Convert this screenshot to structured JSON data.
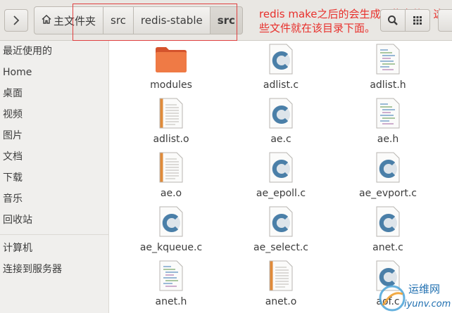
{
  "header": {
    "breadcrumbs": [
      {
        "label": "主文件夹",
        "icon": "home-icon"
      },
      {
        "label": "src"
      },
      {
        "label": "redis-stable"
      },
      {
        "label": "src",
        "active": true
      }
    ],
    "annotation": "redis  make之后的会生成一些文件，这些文件就在该目录下面。",
    "annotation_color": "#e8302c"
  },
  "sidebar": {
    "items": [
      {
        "label": "最近使用的"
      },
      {
        "label": "Home"
      },
      {
        "label": "桌面"
      },
      {
        "label": "视频"
      },
      {
        "label": "图片"
      },
      {
        "label": "文档"
      },
      {
        "label": "下载"
      },
      {
        "label": "音乐"
      },
      {
        "label": "回收站"
      },
      {
        "label": "计算机"
      },
      {
        "label": "连接到服务器"
      }
    ]
  },
  "files": [
    {
      "name": "modules",
      "kind": "folder"
    },
    {
      "name": "adlist.c",
      "kind": "c-source"
    },
    {
      "name": "adlist.h",
      "kind": "header"
    },
    {
      "name": "adlist.o",
      "kind": "object"
    },
    {
      "name": "ae.c",
      "kind": "c-source"
    },
    {
      "name": "ae.h",
      "kind": "header"
    },
    {
      "name": "ae.o",
      "kind": "object"
    },
    {
      "name": "ae_epoll.c",
      "kind": "c-source"
    },
    {
      "name": "ae_evport.c",
      "kind": "c-source"
    },
    {
      "name": "ae_kqueue.c",
      "kind": "c-source"
    },
    {
      "name": "ae_select.c",
      "kind": "c-source"
    },
    {
      "name": "anet.c",
      "kind": "c-source"
    },
    {
      "name": "anet.h",
      "kind": "header"
    },
    {
      "name": "anet.o",
      "kind": "object"
    },
    {
      "name": "aof.c",
      "kind": "c-source"
    }
  ],
  "watermark": {
    "title": "运维网",
    "subtitle": "iyunv.com"
  },
  "colors": {
    "folder": "#e8643c",
    "c_icon": "#4a7fa8",
    "object_stripe": "#e08b3a"
  }
}
